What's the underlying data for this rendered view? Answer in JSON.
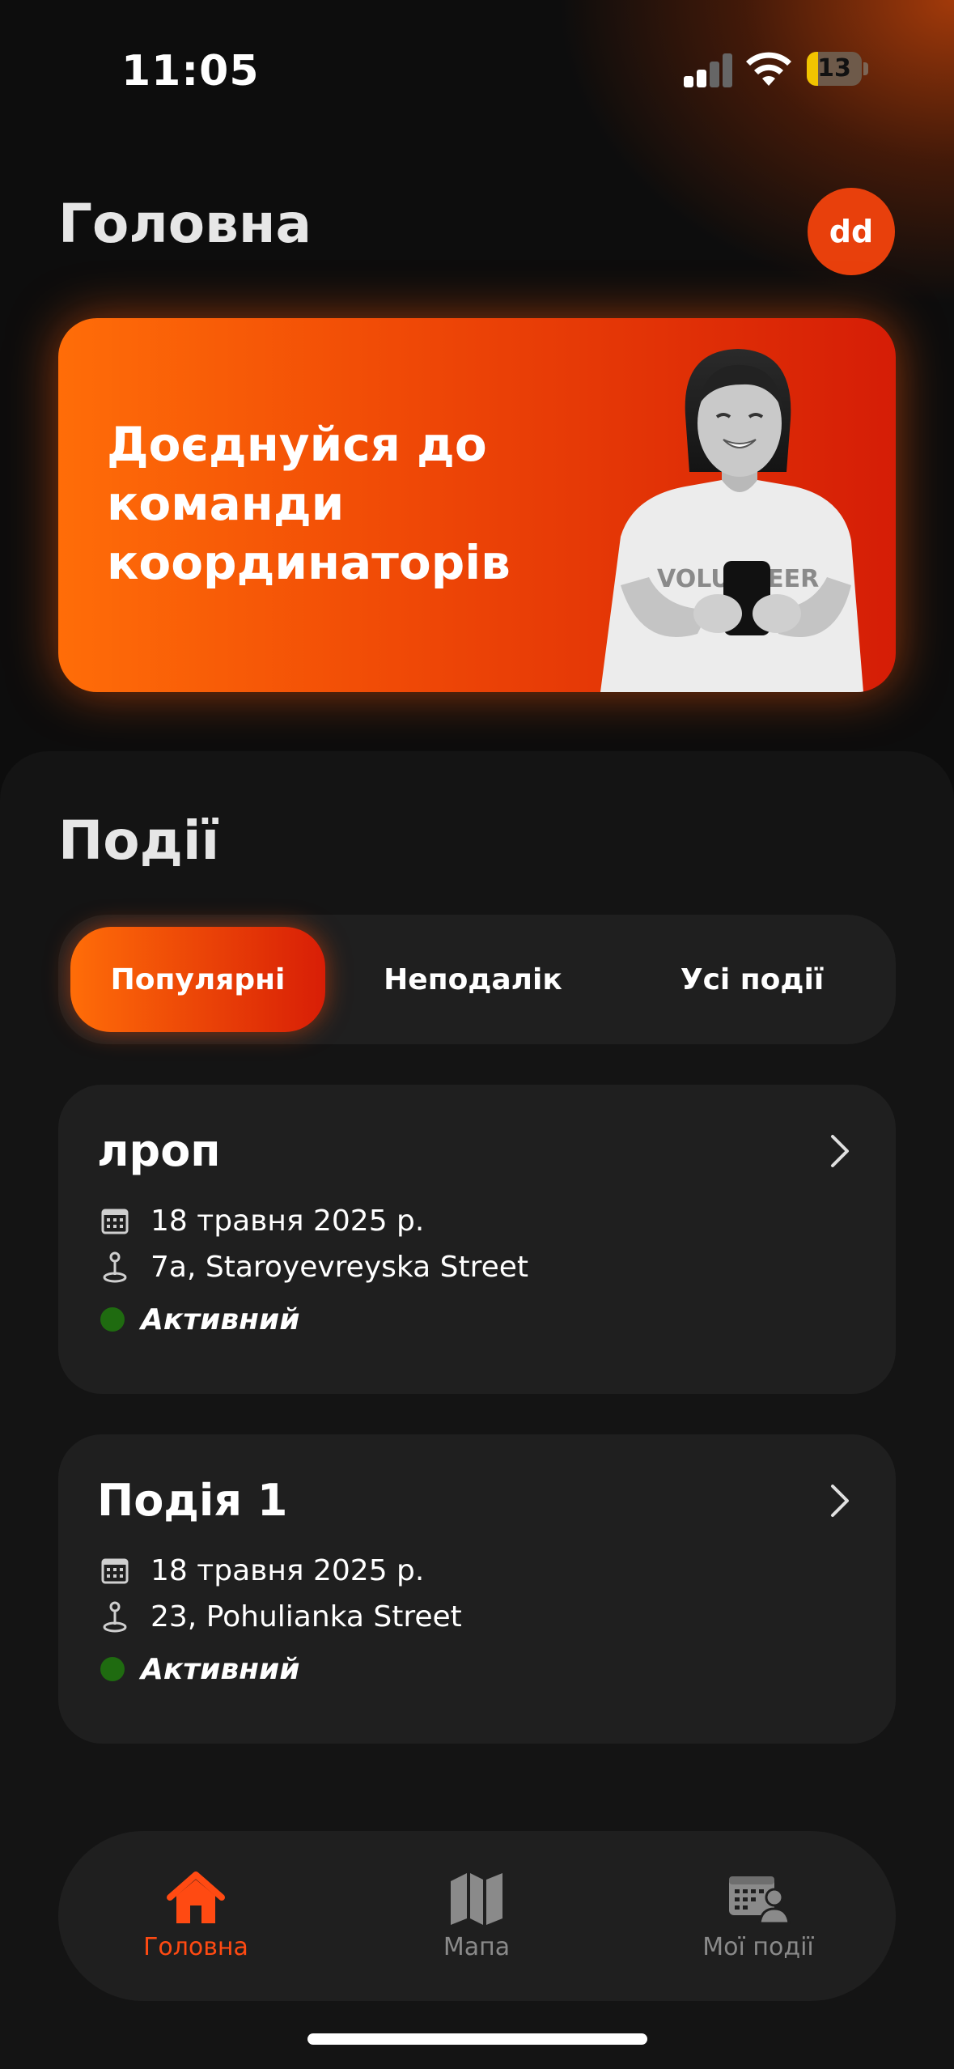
{
  "status_bar": {
    "time": "11:05",
    "battery": "13",
    "battery_level": 0.13
  },
  "header": {
    "title": "Головна",
    "avatar_initials": "dd"
  },
  "banner": {
    "title": "Доєднуйся до команди координаторів",
    "shirt_text": "VOLUNTEER"
  },
  "events": {
    "title": "Події",
    "tabs": [
      {
        "label": "Популярні",
        "active": true
      },
      {
        "label": "Неподалік",
        "active": false
      },
      {
        "label": "Усі події",
        "active": false
      }
    ],
    "cards": [
      {
        "title": "лроп",
        "date": "18 травня 2025 р.",
        "address": "7a, Staroyevreyska Street",
        "status": "Активний"
      },
      {
        "title": "Подія 1",
        "date": "18 травня 2025 р.",
        "address": "23, Pohulianka Street",
        "status": "Активний"
      }
    ]
  },
  "bottom_nav": {
    "items": [
      {
        "label": "Головна",
        "icon": "home-icon",
        "active": true
      },
      {
        "label": "Мапа",
        "icon": "map-icon",
        "active": false
      },
      {
        "label": "Мої події",
        "icon": "my-events-icon",
        "active": false
      }
    ]
  },
  "colors": {
    "accent": "#ff4a12",
    "accent_gradient_start": "#ff6d08",
    "accent_gradient_end": "#d51d06",
    "status_active": "#1f6b10",
    "card_bg": "#1f1f1f",
    "background": "#0d0d0d"
  }
}
